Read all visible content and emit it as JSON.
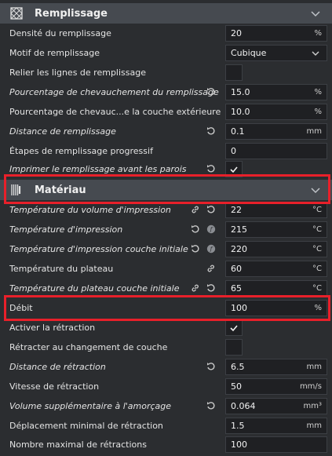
{
  "sections": {
    "infill": {
      "title": "Remplissage"
    },
    "material": {
      "title": "Matériau"
    }
  },
  "rows": {
    "infill_density": {
      "label": "Densité du remplissage",
      "value": "20",
      "unit": "%"
    },
    "infill_pattern": {
      "label": "Motif de remplissage",
      "value": "Cubique"
    },
    "connect_infill_lines": {
      "label": "Relier les lignes de remplissage",
      "checked": false
    },
    "infill_overlap_pct": {
      "label": "Pourcentage de chevauchement du remplissage",
      "value": "15.0",
      "unit": "%"
    },
    "skin_overlap_pct": {
      "label": "Pourcentage de chevauc...e la couche extérieure",
      "value": "10.0",
      "unit": "%"
    },
    "infill_wipe_dist": {
      "label": "Distance de remplissage",
      "value": "0.1",
      "unit": "mm"
    },
    "gradual_infill_steps": {
      "label": "Étapes de remplissage progressif",
      "value": "0"
    },
    "infill_before_walls": {
      "label": "Imprimer le remplissage avant les parois",
      "checked": true
    },
    "build_volume_temp": {
      "label": "Température du volume d'impression",
      "value": "22",
      "unit": "°C"
    },
    "print_temp": {
      "label": "Température d'impression",
      "value": "215",
      "unit": "°C"
    },
    "print_temp_initial": {
      "label": "Température d'impression couche initiale",
      "value": "220",
      "unit": "°C"
    },
    "bed_temp": {
      "label": "Température du plateau",
      "value": "60",
      "unit": "°C"
    },
    "bed_temp_initial": {
      "label": "Température du plateau couche initiale",
      "value": "65",
      "unit": "°C"
    },
    "flow": {
      "label": "Débit",
      "value": "100",
      "unit": "%"
    },
    "retraction_enable": {
      "label": "Activer la rétraction",
      "checked": true
    },
    "retract_layer_change": {
      "label": "Rétracter au changement de couche",
      "checked": false
    },
    "retraction_distance": {
      "label": "Distance de rétraction",
      "value": "6.5",
      "unit": "mm"
    },
    "retraction_speed": {
      "label": "Vitesse de rétraction",
      "value": "50",
      "unit": "mm/s"
    },
    "retraction_extra_prime": {
      "label": "Volume supplémentaire à l'amorçage",
      "value": "0.064",
      "unit": "mm³"
    },
    "retraction_min_travel": {
      "label": "Déplacement minimal de rétraction",
      "value": "1.5",
      "unit": "mm"
    },
    "retraction_count_max": {
      "label": "Nombre maximal de rétractions",
      "value": "100"
    }
  },
  "colors": {
    "highlight": "#e8202a",
    "header": "#464a50",
    "background": "#2b2d30"
  }
}
